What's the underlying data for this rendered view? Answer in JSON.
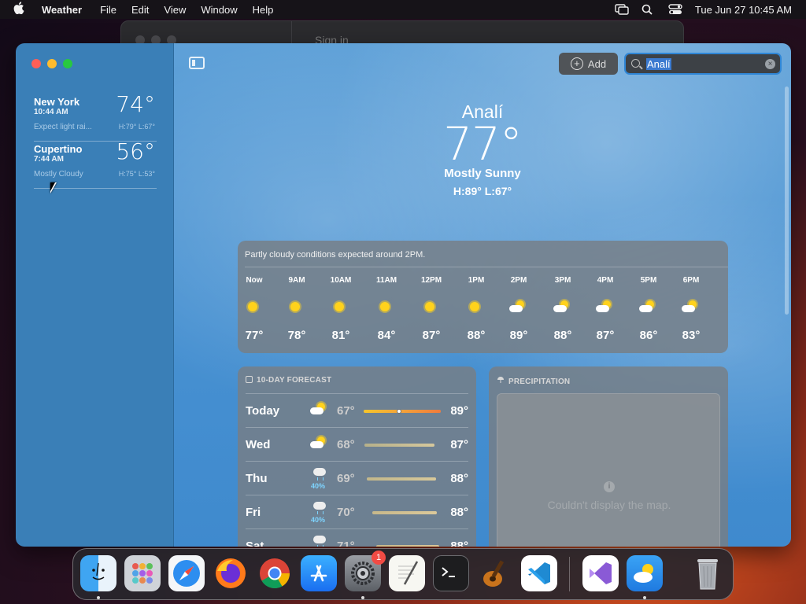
{
  "menubar": {
    "apple_icon": "apple-logo-icon",
    "app_name": "Weather",
    "menus": [
      "File",
      "Edit",
      "View",
      "Window",
      "Help"
    ],
    "status_icons": [
      "screen-mirroring-icon",
      "spotlight-search-icon",
      "control-center-icon"
    ],
    "clock": "Tue Jun 27  10:45 AM"
  },
  "background_window": {
    "title": "Sign in"
  },
  "sidebar": {
    "cities": [
      {
        "name": "New York",
        "time": "10:44 AM",
        "temp": "74°",
        "condition": "Expect light rai...",
        "hl": "H:79°  L:67°"
      },
      {
        "name": "Cupertino",
        "time": "7:44 AM",
        "temp": "56°",
        "condition": "Mostly Cloudy",
        "hl": "H:75°  L:53°"
      }
    ]
  },
  "toolbar": {
    "add_label": "Add",
    "search_value": "Analí"
  },
  "current": {
    "location": "Analí",
    "temp": "77°",
    "condition": "Mostly Sunny",
    "hl": "H:89°  L:67°"
  },
  "hourly": {
    "summary": "Partly cloudy conditions expected around 2PM.",
    "hours": [
      {
        "label": "Now",
        "icon": "sun-icon",
        "temp": "77°"
      },
      {
        "label": "9AM",
        "icon": "sun-icon",
        "temp": "78°"
      },
      {
        "label": "10AM",
        "icon": "sun-icon",
        "temp": "81°"
      },
      {
        "label": "11AM",
        "icon": "sun-icon",
        "temp": "84°"
      },
      {
        "label": "12PM",
        "icon": "sun-icon",
        "temp": "87°"
      },
      {
        "label": "1PM",
        "icon": "sun-icon",
        "temp": "88°"
      },
      {
        "label": "2PM",
        "icon": "partly-cloudy-icon",
        "temp": "89°"
      },
      {
        "label": "3PM",
        "icon": "partly-cloudy-icon",
        "temp": "88°"
      },
      {
        "label": "4PM",
        "icon": "partly-cloudy-icon",
        "temp": "87°"
      },
      {
        "label": "5PM",
        "icon": "partly-cloudy-icon",
        "temp": "86°"
      },
      {
        "label": "6PM",
        "icon": "partly-cloudy-icon",
        "temp": "83°"
      }
    ]
  },
  "forecast": {
    "title": "10-DAY FORECAST",
    "days": [
      {
        "day": "Today",
        "icon": "partly-cloudy-icon",
        "precip": "",
        "low": "67°",
        "high": "89°"
      },
      {
        "day": "Wed",
        "icon": "partly-cloudy-icon",
        "precip": "",
        "low": "68°",
        "high": "87°"
      },
      {
        "day": "Thu",
        "icon": "rain-icon",
        "precip": "40%",
        "low": "69°",
        "high": "88°"
      },
      {
        "day": "Fri",
        "icon": "rain-icon",
        "precip": "40%",
        "low": "70°",
        "high": "88°"
      },
      {
        "day": "Sat",
        "icon": "rain-icon",
        "precip": "",
        "low": "71°",
        "high": "88°"
      }
    ]
  },
  "precipitation": {
    "title": "PRECIPITATION",
    "message": "Couldn't display the map."
  },
  "dock": {
    "apps": [
      "Finder",
      "Launchpad",
      "Safari",
      "Firefox",
      "Chrome",
      "App Store",
      "System Settings",
      "TextEdit",
      "Terminal",
      "GarageBand",
      "Visual Studio Code",
      "Visual Studio",
      "Weather",
      "Trash"
    ],
    "system_settings_badge": "1"
  },
  "colors": {
    "sidebar_bg": "#3a7fb7",
    "sky": "#4a93d2",
    "card": "#787e84",
    "precip_accent": "#7ed4ff",
    "search_focus": "#2f86d6"
  }
}
